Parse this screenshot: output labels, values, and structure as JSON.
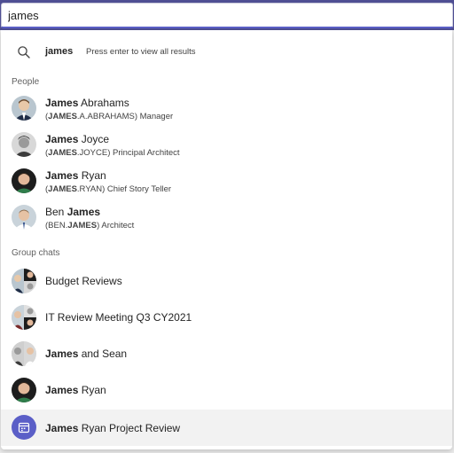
{
  "search": {
    "value": "james",
    "term": "james",
    "hint": "Press enter to view all results"
  },
  "sections": {
    "people": "People",
    "group_chats": "Group chats"
  },
  "people": [
    {
      "first": "James",
      "last": " Abrahams",
      "handle_pre": "(",
      "handle_bold": "JAMES",
      "handle_post": ".A.ABRAHAMS) Manager"
    },
    {
      "first": "James",
      "last": " Joyce",
      "handle_pre": "(",
      "handle_bold": "JAMES",
      "handle_post": ".JOYCE) Principal Architect"
    },
    {
      "first": "James",
      "last": " Ryan",
      "handle_pre": "(",
      "handle_bold": "JAMES",
      "handle_post": ".RYAN) Chief Story Teller"
    },
    {
      "first": "Ben ",
      "last": "James",
      "handle_pre": "(BEN.",
      "handle_bold": "JAMES",
      "handle_post": ") Architect"
    }
  ],
  "chats": [
    {
      "bold": "",
      "rest": "Budget Reviews"
    },
    {
      "bold": "",
      "rest": "IT Review Meeting Q3 CY2021"
    },
    {
      "bold": "James",
      "rest": " and Sean"
    },
    {
      "bold": "James",
      "rest": " Ryan"
    },
    {
      "bold": "James",
      "rest": " Ryan Project Review"
    }
  ],
  "colors": {
    "accent": "#5b5fc7",
    "title_bar": "#4f4f93",
    "hover_row": "#f2f2f2"
  },
  "icons": {
    "search": "search-icon",
    "meeting": "calendar-icon"
  }
}
